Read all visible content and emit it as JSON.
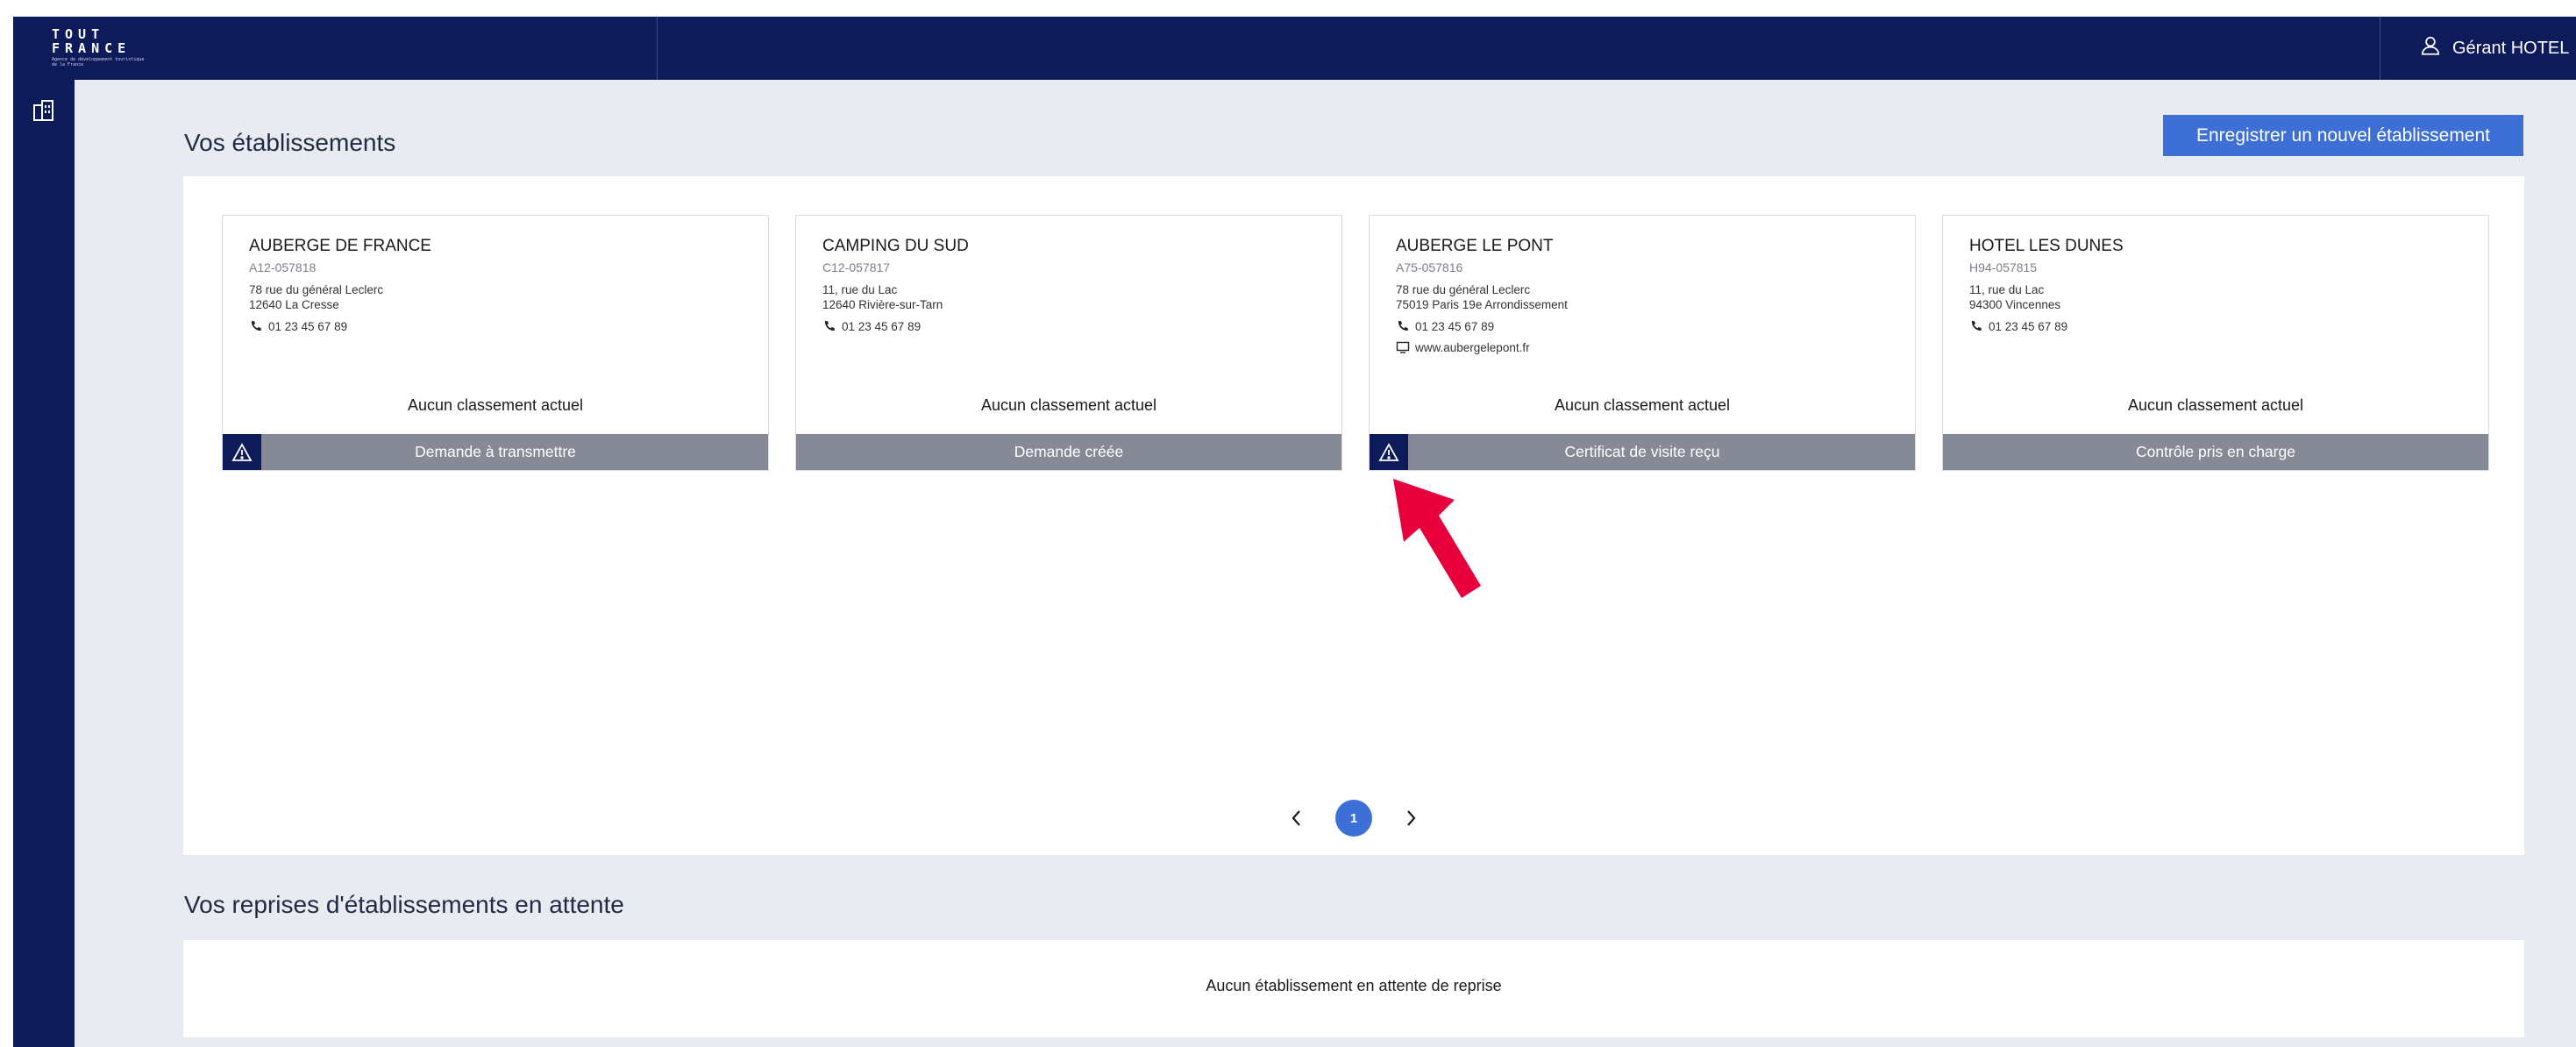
{
  "brand": {
    "logo_line1": "TOUT",
    "logo_line2": "FRANCE",
    "logo_line3": "Agence de développement touristique de la France"
  },
  "user": {
    "label": "Gérant HOTEL",
    "icon": "user-icon"
  },
  "sidebar": {
    "items": [
      {
        "icon": "building-icon"
      }
    ]
  },
  "colors": {
    "navy": "#0d1b5a",
    "accent": "#3d6fd6",
    "status_gray": "#858a96",
    "annotation": "#e8003d"
  },
  "establishments": {
    "title": "Vos établissements",
    "new_button": "Enregistrer un nouvel établissement",
    "cards": [
      {
        "name": "AUBERGE DE FRANCE",
        "code": "A12-057818",
        "address_line1": "78 rue du général Leclerc",
        "address_line2": "12640 La Cresse",
        "phone": "01 23 45 67 89",
        "website": "",
        "ranking": "Aucun classement actuel",
        "status": "Demande à transmettre",
        "warning": true
      },
      {
        "name": "CAMPING DU SUD",
        "code": "C12-057817",
        "address_line1": "11, rue du Lac",
        "address_line2": "12640 Rivière-sur-Tarn",
        "phone": "01 23 45 67 89",
        "website": "",
        "ranking": "Aucun classement actuel",
        "status": "Demande créée",
        "warning": false
      },
      {
        "name": "AUBERGE LE PONT",
        "code": "A75-057816",
        "address_line1": "78 rue du général Leclerc",
        "address_line2": "75019 Paris 19e Arrondissement",
        "phone": "01 23 45 67 89",
        "website": "www.aubergelepont.fr",
        "ranking": "Aucun classement actuel",
        "status": "Certificat de visite reçu",
        "warning": true
      },
      {
        "name": "HOTEL LES DUNES",
        "code": "H94-057815",
        "address_line1": "11, rue du Lac",
        "address_line2": "94300 Vincennes",
        "phone": "01 23 45 67 89",
        "website": "",
        "ranking": "Aucun classement actuel",
        "status": "Contrôle pris en charge",
        "warning": false
      }
    ],
    "pagination": {
      "current_page": "1"
    }
  },
  "pending": {
    "title": "Vos reprises d'établissements en attente",
    "empty_text": "Aucun établissement en attente de reprise"
  }
}
